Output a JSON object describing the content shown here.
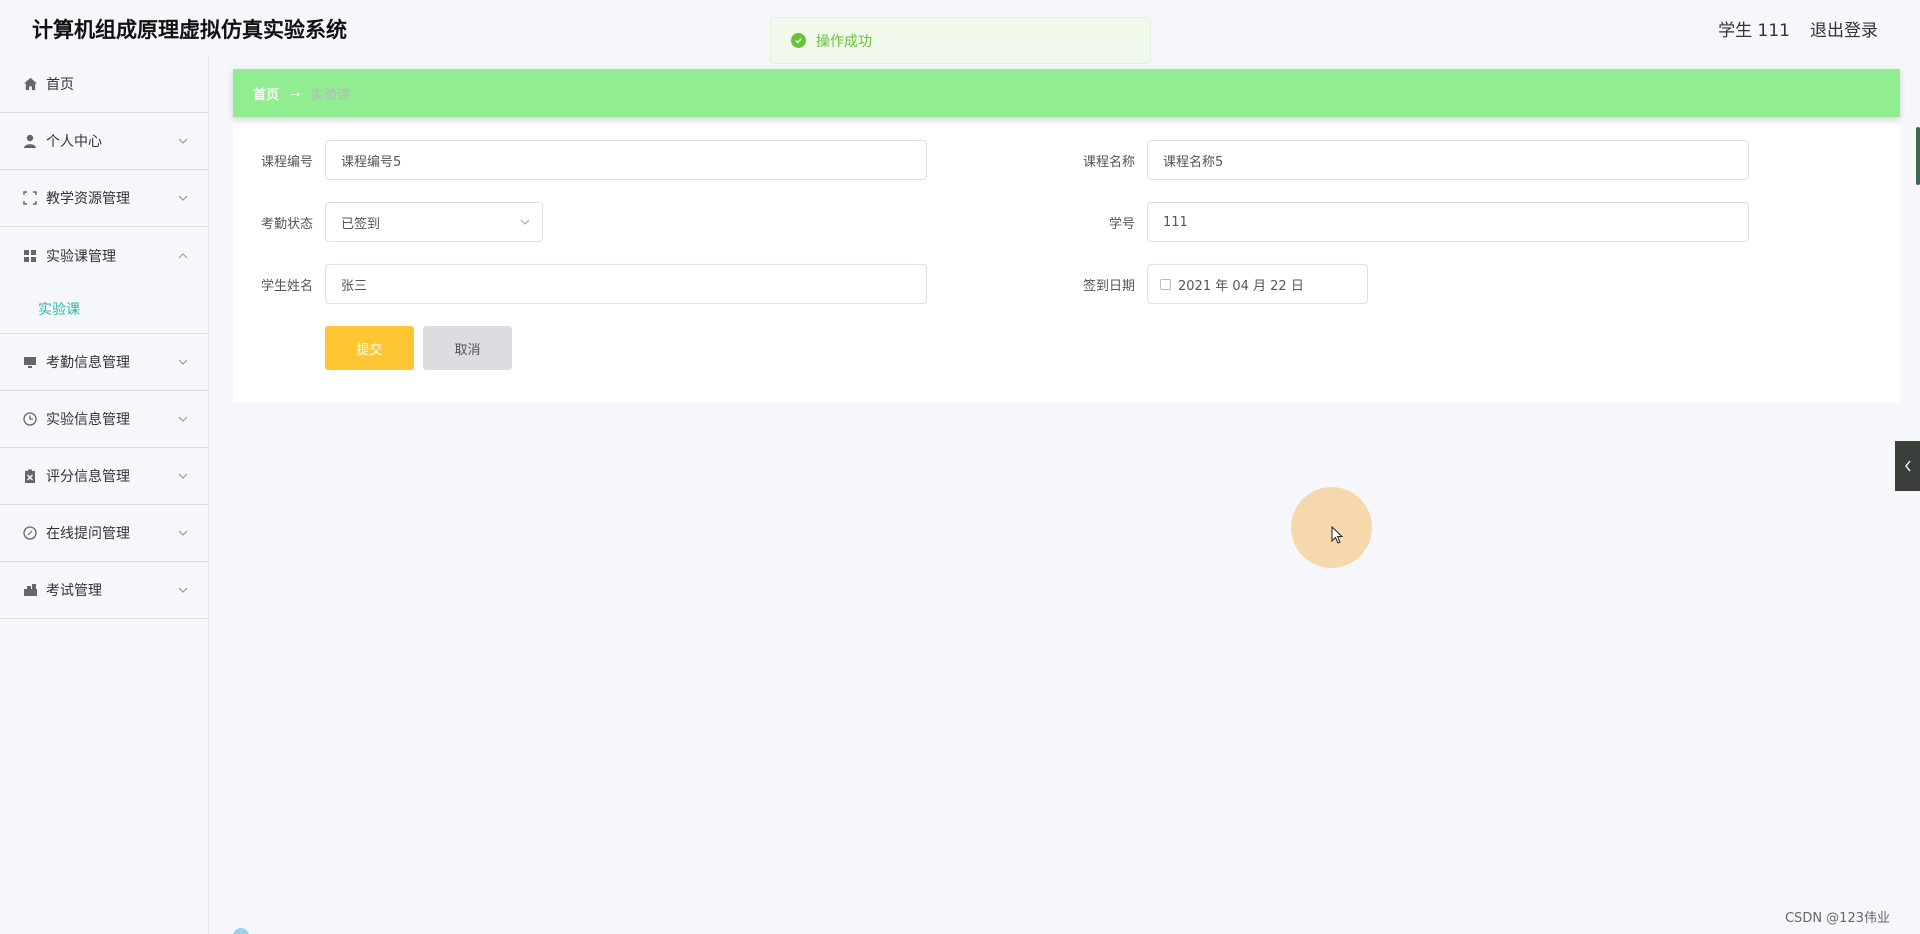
{
  "header": {
    "title": "计算机组成原理虚拟仿真实验系统",
    "user": "学生 111",
    "logout": "退出登录"
  },
  "toast": {
    "message": "操作成功",
    "color": "#67c23a"
  },
  "sidebar": {
    "items": [
      {
        "label": "首页",
        "icon": "home-icon"
      },
      {
        "label": "个人中心",
        "icon": "user-icon"
      },
      {
        "label": "教学资源管理",
        "icon": "expand-icon"
      },
      {
        "label": "实验课管理",
        "icon": "grid-icon",
        "expanded": true,
        "children": [
          {
            "label": "实验课",
            "active": true
          }
        ]
      },
      {
        "label": "考勤信息管理",
        "icon": "monitor-icon"
      },
      {
        "label": "实验信息管理",
        "icon": "clock-icon"
      },
      {
        "label": "评分信息管理",
        "icon": "clipboard-icon"
      },
      {
        "label": "在线提问管理",
        "icon": "compass-icon"
      },
      {
        "label": "考试管理",
        "icon": "cart-icon"
      }
    ],
    "active_color": "#2fb8a8"
  },
  "breadcrumb": {
    "home": "首页",
    "separator": "→",
    "current": "实验课",
    "bar_color": "#90ee90"
  },
  "form": {
    "course_no": {
      "label": "课程编号",
      "value": "课程编号5"
    },
    "course_name": {
      "label": "课程名称",
      "value": "课程名称5"
    },
    "attendance": {
      "label": "考勤状态",
      "value": "已签到"
    },
    "student_no": {
      "label": "学号",
      "value": "111"
    },
    "student_name": {
      "label": "学生姓名",
      "value": "张三"
    },
    "sign_date": {
      "label": "签到日期",
      "value": "2021 年 04 月 22 日"
    },
    "submit": "提交",
    "cancel": "取消",
    "submit_color": "#fdc632"
  },
  "watermark": "CSDN @123伟业"
}
